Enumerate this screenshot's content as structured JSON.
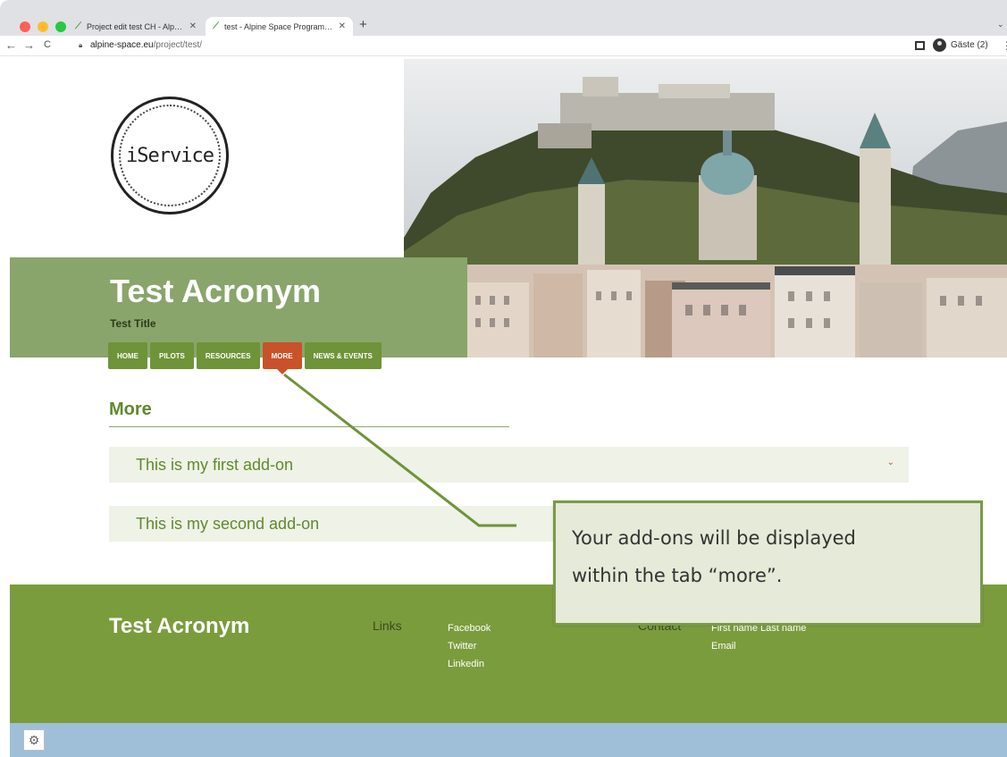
{
  "browser": {
    "tabs": [
      {
        "title": "Project edit test CH - Alpine Sp",
        "active": false
      },
      {
        "title": "test - Alpine Space Programme",
        "active": true
      }
    ],
    "new_tab": "+",
    "tab_list": "⌄",
    "url_domain": "alpine-space.eu",
    "url_path": "/project/test/",
    "profile_label": "Gäste (2)",
    "back": "←",
    "forward": "→",
    "reload": "C",
    "menu": "⋮"
  },
  "header": {
    "logo_text": "iService",
    "acronym": "Test Acronym",
    "title": "Test Title"
  },
  "nav": {
    "items": [
      "HOME",
      "PILOTS",
      "RESOURCES",
      "MORE",
      "NEWS & EVENTS"
    ],
    "active": "MORE"
  },
  "main": {
    "section_title": "More",
    "addons": [
      {
        "label": "This is my first add-on",
        "chevron": "⌄"
      },
      {
        "label": "This is my second add-on"
      }
    ]
  },
  "callout": {
    "line1": "Your add-ons will be displayed",
    "line2": "within the tab “more”."
  },
  "footer": {
    "acronym": "Test Acronym",
    "links_heading": "Links",
    "links": [
      "Facebook",
      "Twitter",
      "Linkedin"
    ],
    "contact_heading": "Contact",
    "contact": [
      "First name Last name",
      "Email"
    ]
  },
  "colors": {
    "band_green": "#89a56b",
    "nav_green": "#6f9339",
    "nav_active": "#c9522a",
    "footer_green": "#7b9c3d",
    "bottom_bar": "#9fbfd8"
  },
  "icons": {
    "lock": "lock-icon",
    "settings": "gear-icon",
    "chevron": "chevron-down-icon"
  }
}
